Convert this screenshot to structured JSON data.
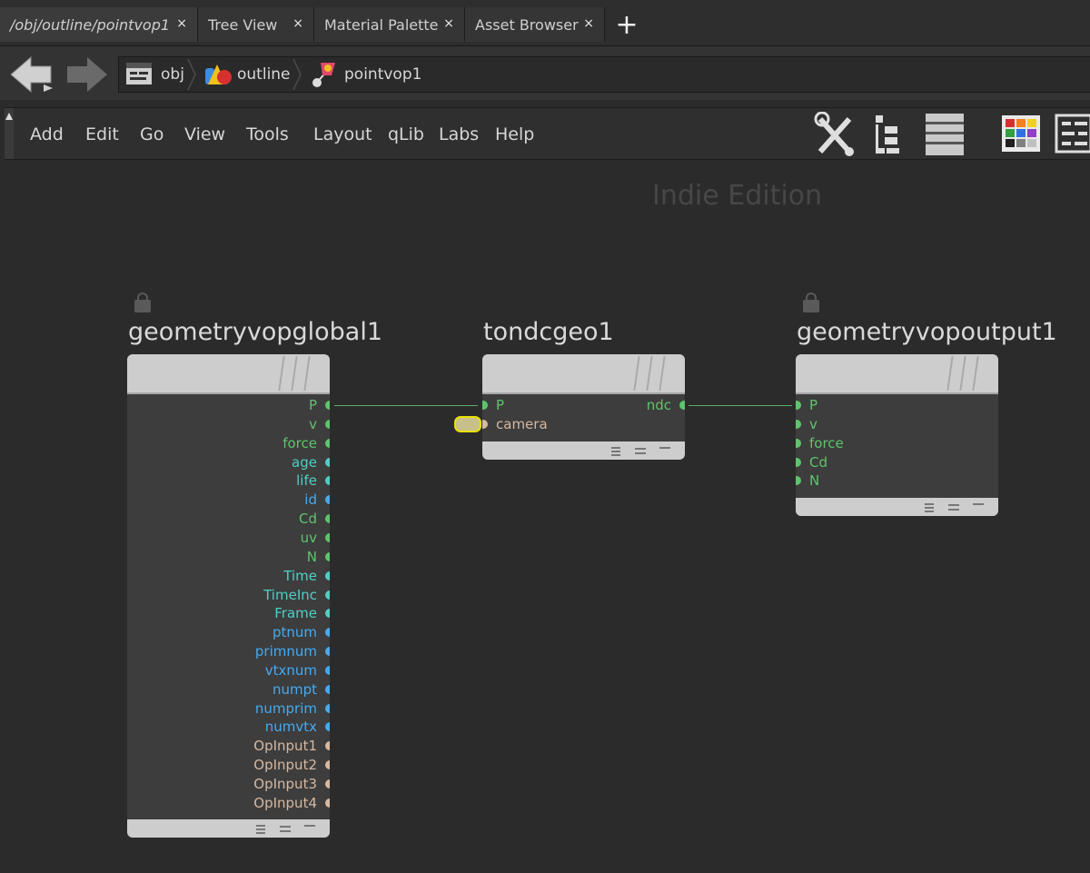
{
  "tabs": [
    {
      "label": "/obj/outline/pointvop1",
      "close": "×"
    },
    {
      "label": "Tree View",
      "close": "×"
    },
    {
      "label": "Material Palette",
      "close": "×"
    },
    {
      "label": "Asset Browser",
      "close": "×"
    }
  ],
  "add_tab": "+",
  "path": [
    "obj",
    "outline",
    "pointvop1"
  ],
  "menu": [
    "Add",
    "Edit",
    "Go",
    "View",
    "Tools",
    "Layout",
    "qLib",
    "Labs",
    "Help"
  ],
  "watermark": "Indie Edition",
  "nodes": {
    "global": {
      "title": "geometryvopglobal1",
      "outputs": [
        "P",
        "v",
        "force",
        "age",
        "life",
        "id",
        "Cd",
        "uv",
        "N",
        "Time",
        "TimeInc",
        "Frame",
        "ptnum",
        "primnum",
        "vtxnum",
        "numpt",
        "numprim",
        "numvtx",
        "OpInput1",
        "OpInput2",
        "OpInput3",
        "OpInput4"
      ]
    },
    "tondc": {
      "title": "tondcgeo1",
      "inputs": [
        "P",
        "camera"
      ],
      "outputs": [
        "ndc"
      ]
    },
    "output": {
      "title": "geometryvopoutput1",
      "inputs": [
        "P",
        "v",
        "force",
        "Cd",
        "N"
      ]
    }
  },
  "colors": {
    "vector": "#5fc36d",
    "float": "#4fcfc4",
    "integer": "#45aaf0",
    "string": "#d7b8a0",
    "highlight": "#e8e000"
  }
}
